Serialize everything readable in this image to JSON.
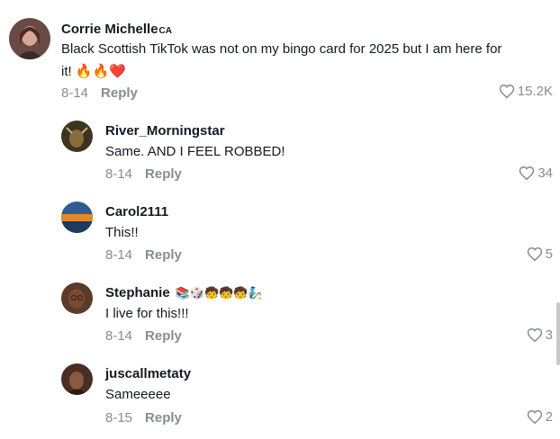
{
  "comments": [
    {
      "name": "Corrie Michelle",
      "region": "CA",
      "text": "Black Scottish TikTok was not on my bingo card for 2025 but I am here for it! 🔥🔥❤️",
      "date": "8-14",
      "reply_label": "Reply",
      "likes": "15.2K"
    }
  ],
  "replies": [
    {
      "name": "River_Morningstar",
      "text": "Same. AND I FEEL ROBBED!",
      "date": "8-14",
      "reply_label": "Reply",
      "likes": "34"
    },
    {
      "name": "Carol2111",
      "text": "This!!",
      "date": "8-14",
      "reply_label": "Reply",
      "likes": "5"
    },
    {
      "name": "Stephanie",
      "name_emojis": "📚🎲🧒🧒🧒🧞",
      "text": "I live for this!!!",
      "date": "8-14",
      "reply_label": "Reply",
      "likes": "3"
    },
    {
      "name": "juscallmetaty",
      "text": "Sameeeee",
      "date": "8-15",
      "reply_label": "Reply",
      "likes": "2"
    }
  ]
}
